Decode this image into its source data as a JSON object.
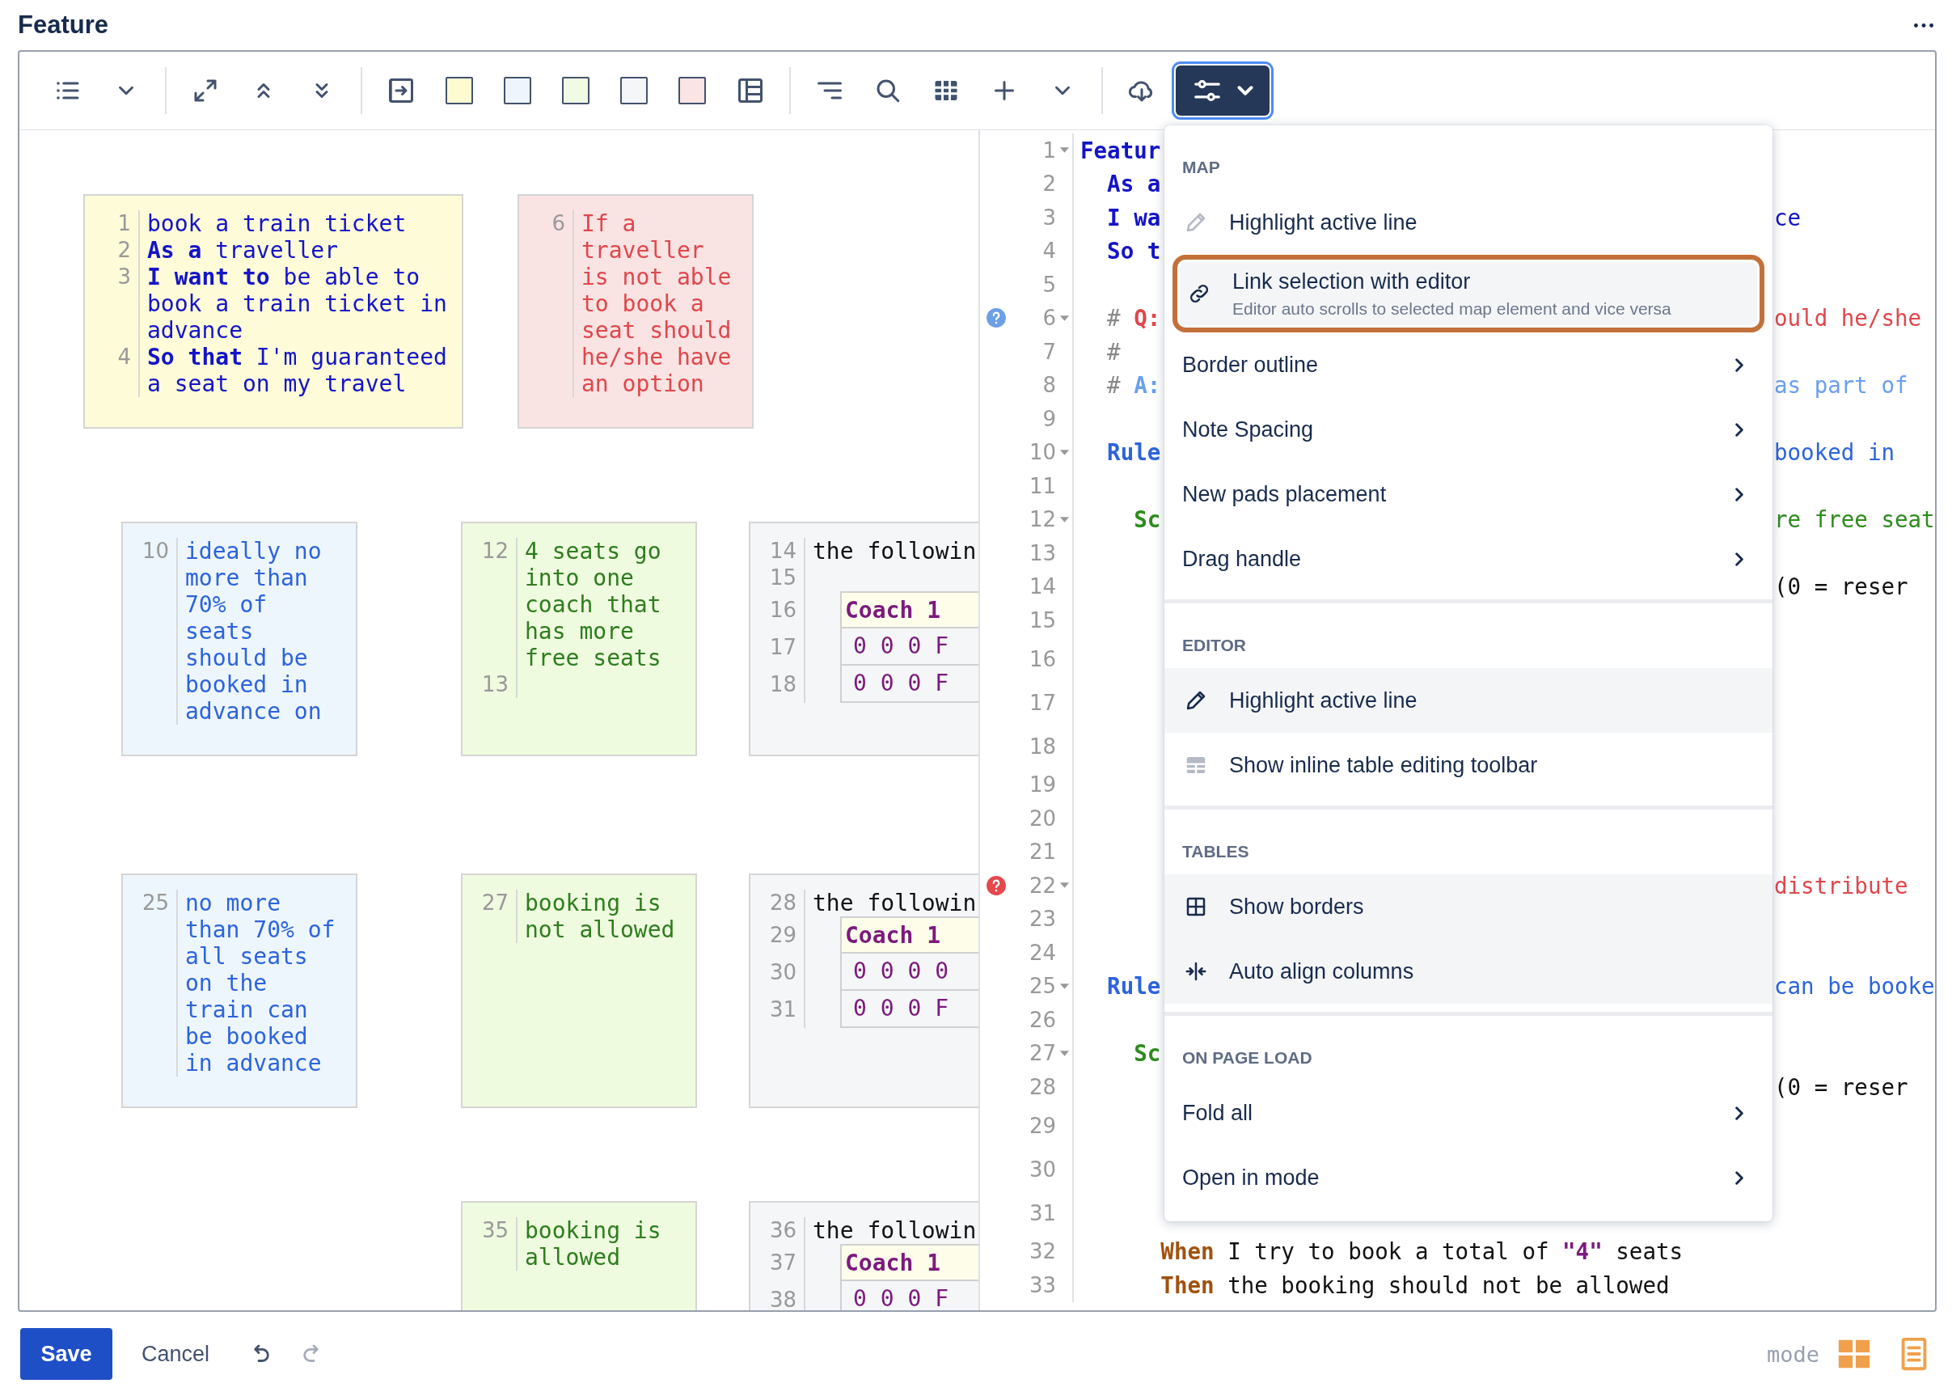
{
  "title": "Feature",
  "toolbar": {
    "note_colors": [
      {
        "color": "#fffbd1"
      },
      {
        "color": "#eef5fd"
      },
      {
        "color": "#effbe2"
      },
      {
        "color": "#f5f6f8"
      },
      {
        "color": "#fbe4e4"
      }
    ],
    "settings_button": {
      "selected": true
    }
  },
  "map": {
    "notes": [
      {
        "kind": "feature",
        "lines": [
          {
            "kind": "text",
            "number": "1",
            "text": "book a train ticket"
          },
          {
            "kind": "text",
            "number": "2",
            "text": "**As a** traveller"
          },
          {
            "kind": "text",
            "number": "3",
            "text": "**I want to** be able to book a train ticket in advance"
          },
          {
            "kind": "text",
            "number": "4",
            "text": "**So that** I'm guaranteed a seat on my travel"
          }
        ]
      },
      {
        "kind": "question",
        "lines": [
          {
            "kind": "text",
            "number": "6",
            "text": "If a traveller is not able to book a seat should he/she have an option"
          }
        ]
      },
      {
        "kind": "rule",
        "lines": [
          {
            "kind": "text",
            "number": "10",
            "text": "ideally no more than 70% of seats should be booked in advance on"
          }
        ]
      },
      {
        "kind": "scenario",
        "lines": [
          {
            "kind": "text",
            "number": "12",
            "text": "4 seats go into one coach that has more free seats"
          },
          {
            "kind": "blank",
            "number": "13"
          }
        ]
      },
      {
        "kind": "example",
        "lines": [
          {
            "kind": "text",
            "number": "14",
            "text": "the followin"
          },
          {
            "kind": "blank",
            "number": "15"
          },
          {
            "kind": "table-head",
            "number": "16",
            "text": "Coach 1"
          },
          {
            "kind": "table-row",
            "number": "17",
            "text": "0 0 0 F"
          },
          {
            "kind": "table-row",
            "number": "18",
            "text": "0 0 0 F"
          }
        ]
      },
      {
        "kind": "rule",
        "lines": [
          {
            "kind": "text",
            "number": "25",
            "text": "no more than 70% of all seats on the train can be booked in advance"
          }
        ]
      },
      {
        "kind": "scenario",
        "lines": [
          {
            "kind": "text",
            "number": "27",
            "text": "booking is not allowed"
          }
        ]
      },
      {
        "kind": "example",
        "lines": [
          {
            "kind": "text",
            "number": "28",
            "text": "the followin"
          },
          {
            "kind": "table-head",
            "number": "29",
            "text": "Coach 1"
          },
          {
            "kind": "table-row",
            "number": "30",
            "text": "0 0 0 0"
          },
          {
            "kind": "table-row",
            "number": "31",
            "text": "0 0 0 F"
          }
        ]
      },
      {
        "kind": "scenario",
        "lines": [
          {
            "kind": "text",
            "number": "35",
            "text": "booking is allowed"
          }
        ]
      },
      {
        "kind": "example",
        "lines": [
          {
            "kind": "text",
            "number": "36",
            "text": "the followin"
          },
          {
            "kind": "table-head",
            "number": "37",
            "text": "Coach 1"
          },
          {
            "kind": "table-row",
            "number": "38",
            "text": "0 0 0 F"
          }
        ]
      }
    ]
  },
  "editor": {
    "lines": [
      {
        "number": "1",
        "fold": true,
        "kind": "text",
        "start": [
          {
            "kind": "keyword",
            "text": "Featur"
          }
        ]
      },
      {
        "number": "2",
        "fold": false,
        "kind": "text",
        "start": [
          {
            "kind": "keyword",
            "text": "  As a"
          }
        ]
      },
      {
        "number": "3",
        "fold": false,
        "kind": "text",
        "start": [
          {
            "kind": "keyword",
            "text": "  I wa"
          }
        ],
        "end": [
          {
            "kind": "narrative",
            "text": "ce"
          }
        ]
      },
      {
        "number": "4",
        "fold": false,
        "kind": "text",
        "start": [
          {
            "kind": "keyword",
            "text": "  So t"
          }
        ]
      },
      {
        "number": "5",
        "fold": false,
        "kind": "text"
      },
      {
        "number": "6",
        "fold": true,
        "kind": "text",
        "marker": {
          "color": "#6d9fe6"
        },
        "start": [
          {
            "kind": "comment",
            "text": "  # "
          },
          {
            "kind": "question",
            "text": "Q:"
          }
        ],
        "end": [
          {
            "kind": "question-text",
            "text": "ould he/she"
          }
        ]
      },
      {
        "number": "7",
        "fold": false,
        "kind": "text",
        "start": [
          {
            "kind": "comment",
            "text": "  #"
          }
        ]
      },
      {
        "number": "8",
        "fold": false,
        "kind": "text",
        "start": [
          {
            "kind": "comment",
            "text": "  # "
          },
          {
            "kind": "answer",
            "text": "A:"
          }
        ],
        "end": [
          {
            "kind": "answer-text",
            "text": "as part of"
          }
        ]
      },
      {
        "number": "9",
        "fold": false,
        "kind": "text"
      },
      {
        "number": "10",
        "fold": true,
        "kind": "text",
        "start": [
          {
            "kind": "rule",
            "text": "  Rule"
          }
        ],
        "end": [
          {
            "kind": "rule-text",
            "text": "booked in"
          }
        ]
      },
      {
        "number": "11",
        "fold": false,
        "kind": "text"
      },
      {
        "number": "12",
        "fold": true,
        "kind": "text",
        "start": [
          {
            "kind": "scenario",
            "text": "    Sc"
          }
        ],
        "end": [
          {
            "kind": "scenario-text",
            "text": "re free seat"
          }
        ]
      },
      {
        "number": "13",
        "fold": false,
        "kind": "text"
      },
      {
        "number": "14",
        "fold": false,
        "kind": "text",
        "end": [
          {
            "kind": "plain",
            "text": "(0 = reser"
          }
        ]
      },
      {
        "number": "15",
        "fold": false,
        "kind": "text"
      },
      {
        "number": "16",
        "fold": false,
        "kind": "table"
      },
      {
        "number": "17",
        "fold": false,
        "kind": "table"
      },
      {
        "number": "18",
        "fold": false,
        "kind": "table"
      },
      {
        "number": "19",
        "fold": false,
        "kind": "text"
      },
      {
        "number": "20",
        "fold": false,
        "kind": "text"
      },
      {
        "number": "21",
        "fold": false,
        "kind": "text"
      },
      {
        "number": "22",
        "fold": true,
        "kind": "text",
        "marker": {
          "color": "#e5484d"
        },
        "end": [
          {
            "kind": "question-text",
            "text": "distribute"
          }
        ]
      },
      {
        "number": "23",
        "fold": false,
        "kind": "text"
      },
      {
        "number": "24",
        "fold": false,
        "kind": "text"
      },
      {
        "number": "25",
        "fold": true,
        "kind": "text",
        "start": [
          {
            "kind": "rule",
            "text": "  Rule"
          }
        ],
        "end": [
          {
            "kind": "rule-text",
            "text": "can be booke"
          }
        ]
      },
      {
        "number": "26",
        "fold": false,
        "kind": "text"
      },
      {
        "number": "27",
        "fold": true,
        "kind": "text",
        "start": [
          {
            "kind": "scenario",
            "text": "    Sc"
          }
        ]
      },
      {
        "number": "28",
        "fold": false,
        "kind": "text",
        "end": [
          {
            "kind": "plain",
            "text": "(0 = reser"
          }
        ]
      },
      {
        "number": "29",
        "fold": false,
        "kind": "table"
      },
      {
        "number": "30",
        "fold": false,
        "kind": "table"
      },
      {
        "number": "31",
        "fold": false,
        "kind": "table"
      },
      {
        "number": "32",
        "fold": false,
        "kind": "text",
        "start": [
          {
            "kind": "step",
            "text": "      When"
          },
          {
            "kind": "plain",
            "text": " I try to book a total of "
          },
          {
            "kind": "string",
            "text": "\"4\""
          },
          {
            "kind": "plain",
            "text": " seats"
          }
        ]
      },
      {
        "number": "33",
        "fold": false,
        "kind": "text",
        "start": [
          {
            "kind": "step",
            "text": "      Then"
          },
          {
            "kind": "plain",
            "text": " the booking should not be allowed"
          }
        ]
      }
    ]
  },
  "settings_menu": {
    "sections": [
      {
        "heading": "MAP",
        "items": [
          {
            "kind": "toggle",
            "label": "Highlight active line",
            "on": false,
            "focused": false
          },
          {
            "kind": "toggle",
            "label": "Link selection with editor",
            "description": "Editor auto scrolls to selected map element and vice versa",
            "on": true,
            "focused": true
          },
          {
            "kind": "submenu",
            "label": "Border outline"
          },
          {
            "kind": "submenu",
            "label": "Note Spacing"
          },
          {
            "kind": "submenu",
            "label": "New pads placement"
          },
          {
            "kind": "submenu",
            "label": "Drag handle"
          }
        ]
      },
      {
        "heading": "EDITOR",
        "items": [
          {
            "kind": "toggle",
            "label": "Highlight active line",
            "on": true,
            "focused": false
          },
          {
            "kind": "toggle",
            "label": "Show inline table editing toolbar",
            "on": false,
            "focused": false
          }
        ]
      },
      {
        "heading": "TABLES",
        "items": [
          {
            "kind": "toggle",
            "label": "Show borders",
            "on": true,
            "focused": false
          },
          {
            "kind": "toggle",
            "label": "Auto align columns",
            "on": true,
            "focused": false
          }
        ]
      },
      {
        "heading": "ON PAGE LOAD",
        "items": [
          {
            "kind": "submenu",
            "label": "Fold all"
          },
          {
            "kind": "submenu",
            "label": "Open in mode"
          }
        ]
      }
    ]
  },
  "footer": {
    "save": "Save",
    "cancel": "Cancel",
    "undo": {
      "disabled": false
    },
    "redo": {
      "disabled": true
    },
    "mode_label": "mode"
  }
}
